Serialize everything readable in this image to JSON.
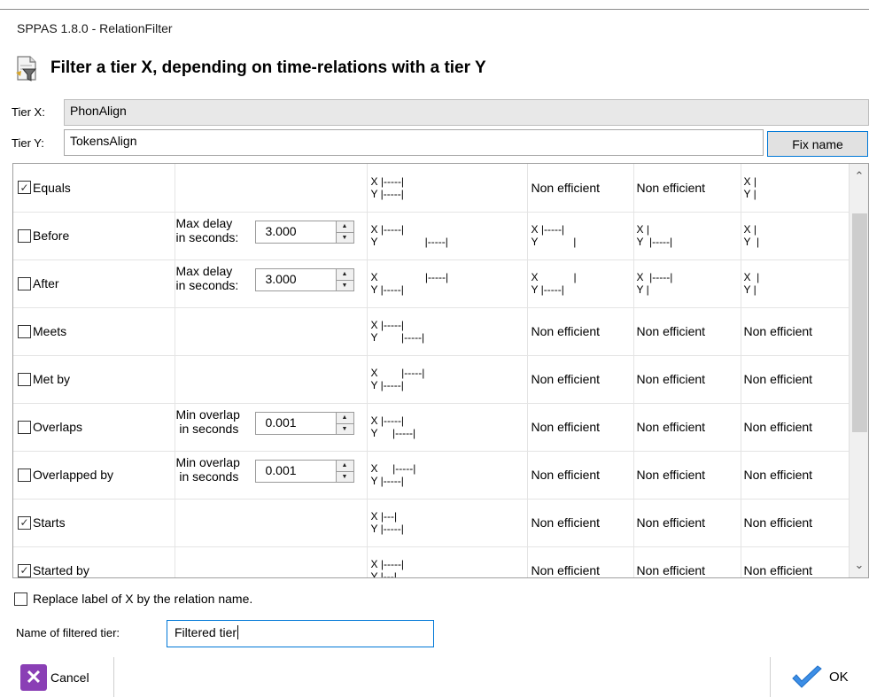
{
  "window": {
    "title": "SPPAS 1.8.0  - RelationFilter"
  },
  "header": {
    "title": "Filter a tier X, depending on time-relations with a tier Y",
    "icon": "filter-document-icon"
  },
  "tiers": {
    "x_label": "Tier X:",
    "x_value": "PhonAlign",
    "y_label": "Tier Y:",
    "y_value": "TokensAlign",
    "fix_name_label": "Fix name"
  },
  "relations": [
    {
      "name": "Equals",
      "checked": true,
      "option_label": "",
      "option_value": "",
      "diagram": "X |-----|\nY |-----|",
      "e1": "Non efficient",
      "e2": "Non efficient",
      "e3": "X |\nY |"
    },
    {
      "name": "Before",
      "checked": false,
      "option_label": "Max delay\nin seconds:",
      "option_value": "3.000",
      "diagram": "X |-----|\nY                |-----|",
      "e1": "X |-----|\nY            |",
      "e2": "X |\nY  |-----|",
      "e3": "X |\nY  |"
    },
    {
      "name": "After",
      "checked": false,
      "option_label": "Max delay\nin seconds:",
      "option_value": "3.000",
      "diagram": "X                |-----|\nY |-----|",
      "e1": "X            |\nY |-----|",
      "e2": "X  |-----|\nY |",
      "e3": "X  |\nY |"
    },
    {
      "name": "Meets",
      "checked": false,
      "option_label": "",
      "option_value": "",
      "diagram": "X |-----|\nY        |-----|",
      "e1": "Non efficient",
      "e2": "Non efficient",
      "e3": "Non efficient"
    },
    {
      "name": "Met by",
      "checked": false,
      "option_label": "",
      "option_value": "",
      "diagram": "X        |-----|\nY |-----|",
      "e1": "Non efficient",
      "e2": "Non efficient",
      "e3": "Non efficient"
    },
    {
      "name": "Overlaps",
      "checked": false,
      "option_label": "Min overlap\n in seconds",
      "option_value": "0.001",
      "diagram": "X |-----|\nY     |-----|",
      "e1": "Non efficient",
      "e2": "Non efficient",
      "e3": "Non efficient"
    },
    {
      "name": "Overlapped by",
      "checked": false,
      "option_label": "Min overlap\n in seconds",
      "option_value": "0.001",
      "diagram": "X     |-----|\nY |-----|",
      "e1": "Non efficient",
      "e2": "Non efficient",
      "e3": "Non efficient"
    },
    {
      "name": "Starts",
      "checked": true,
      "option_label": "",
      "option_value": "",
      "diagram": "X |---|\nY |-----|",
      "e1": "Non efficient",
      "e2": "Non efficient",
      "e3": "Non efficient"
    },
    {
      "name": "Started by",
      "checked": true,
      "option_label": "",
      "option_value": "",
      "diagram": "X |-----|\nY |---|",
      "e1": "Non efficient",
      "e2": "Non efficient",
      "e3": "Non efficient"
    }
  ],
  "footer": {
    "replace_label": "Replace label of X by the relation name.",
    "replace_checked": false,
    "name_label": "Name of filtered tier:",
    "name_value": "Filtered tier",
    "cancel_label": "Cancel",
    "ok_label": "OK"
  },
  "colors": {
    "accent": "#0078d7",
    "cancel_icon": "#8a3fb5",
    "ok_check": "#3c8ee6"
  }
}
